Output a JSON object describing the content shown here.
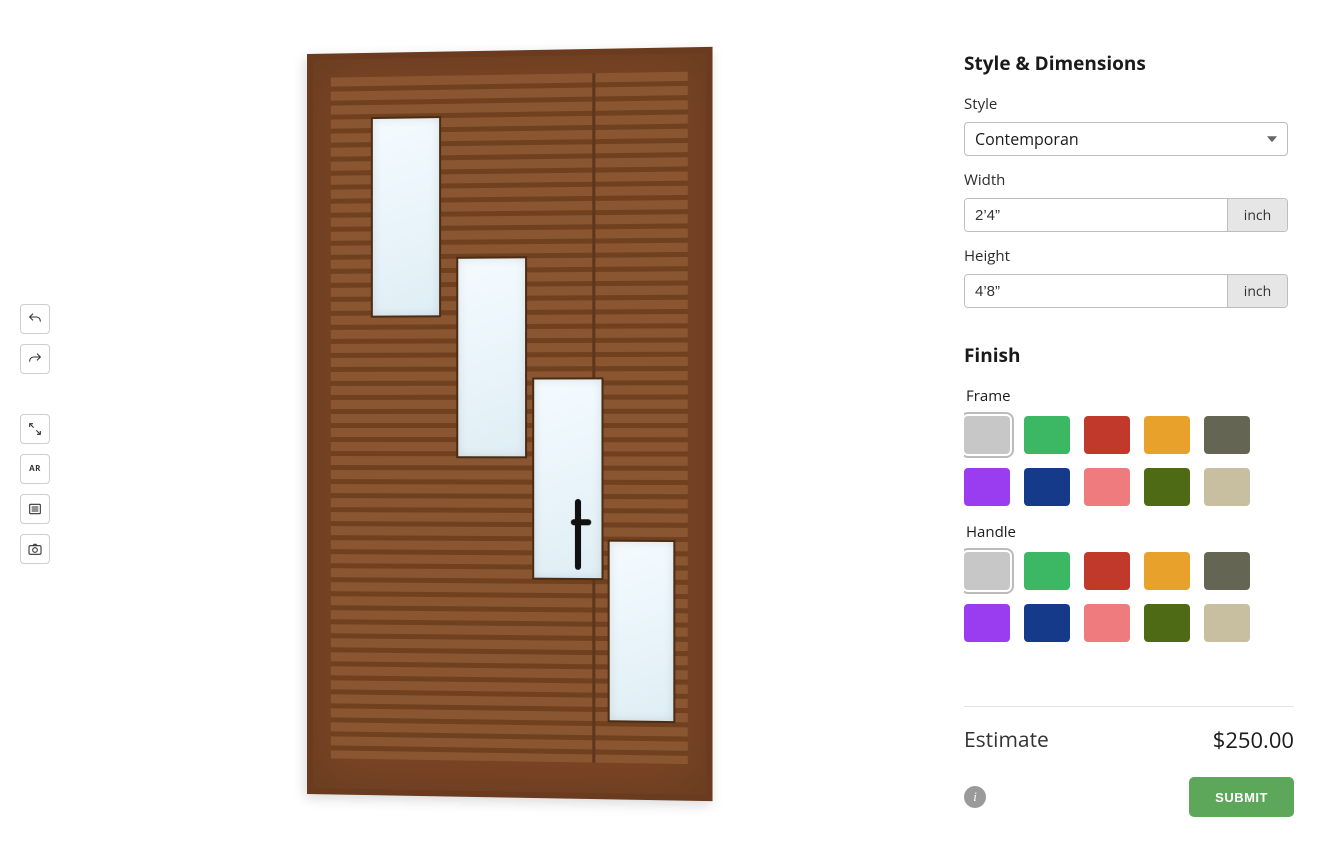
{
  "toolbar": {
    "undo": "undo",
    "redo": "redo",
    "fullscreen": "fullscreen",
    "ar_label": "AR",
    "list": "list",
    "camera": "camera"
  },
  "panel": {
    "section_style_dimensions": "Style & Dimensions",
    "style_label": "Style",
    "style_value": "Contemporan",
    "width_label": "Width",
    "width_value": "2’4”",
    "width_unit": "inch",
    "height_label": "Height",
    "height_value": "4’8”",
    "height_unit": "inch",
    "section_finish": "Finish",
    "frame_label": "Frame",
    "handle_label": "Handle"
  },
  "swatches": {
    "frame": [
      {
        "name": "light-gray",
        "hex": "#c7c7c7",
        "selected": true
      },
      {
        "name": "green",
        "hex": "#3cb864",
        "selected": false
      },
      {
        "name": "red",
        "hex": "#c0392b",
        "selected": false
      },
      {
        "name": "orange",
        "hex": "#e8a12a",
        "selected": false
      },
      {
        "name": "olive-gray",
        "hex": "#656553",
        "selected": false
      },
      {
        "name": "purple",
        "hex": "#9a3cf0",
        "selected": false
      },
      {
        "name": "navy",
        "hex": "#163a8a",
        "selected": false
      },
      {
        "name": "coral",
        "hex": "#f07b7e",
        "selected": false
      },
      {
        "name": "dark-olive",
        "hex": "#4f6a14",
        "selected": false
      },
      {
        "name": "khaki",
        "hex": "#c8bfa0",
        "selected": false
      }
    ],
    "handle": [
      {
        "name": "light-gray",
        "hex": "#c7c7c7",
        "selected": true
      },
      {
        "name": "green",
        "hex": "#3cb864",
        "selected": false
      },
      {
        "name": "red",
        "hex": "#c0392b",
        "selected": false
      },
      {
        "name": "orange",
        "hex": "#e8a12a",
        "selected": false
      },
      {
        "name": "olive-gray",
        "hex": "#656553",
        "selected": false
      },
      {
        "name": "purple",
        "hex": "#9a3cf0",
        "selected": false
      },
      {
        "name": "navy",
        "hex": "#163a8a",
        "selected": false
      },
      {
        "name": "coral",
        "hex": "#f07b7e",
        "selected": false
      },
      {
        "name": "dark-olive",
        "hex": "#4f6a14",
        "selected": false
      },
      {
        "name": "khaki",
        "hex": "#c8bfa0",
        "selected": false
      }
    ]
  },
  "footer": {
    "estimate_label": "Estimate",
    "estimate_value": "$250.00",
    "submit_label": "SUBMIT"
  }
}
